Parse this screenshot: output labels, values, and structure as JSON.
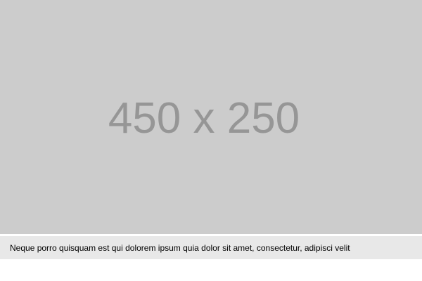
{
  "image": {
    "placeholder_text": "450 x 250",
    "background_color": "#cccccc",
    "text_color": "#969696"
  },
  "caption": {
    "text": "Neque porro quisquam est qui dolorem ipsum quia dolor sit amet, consectetur, adipisci velit",
    "background_color": "#e8e8e8"
  }
}
